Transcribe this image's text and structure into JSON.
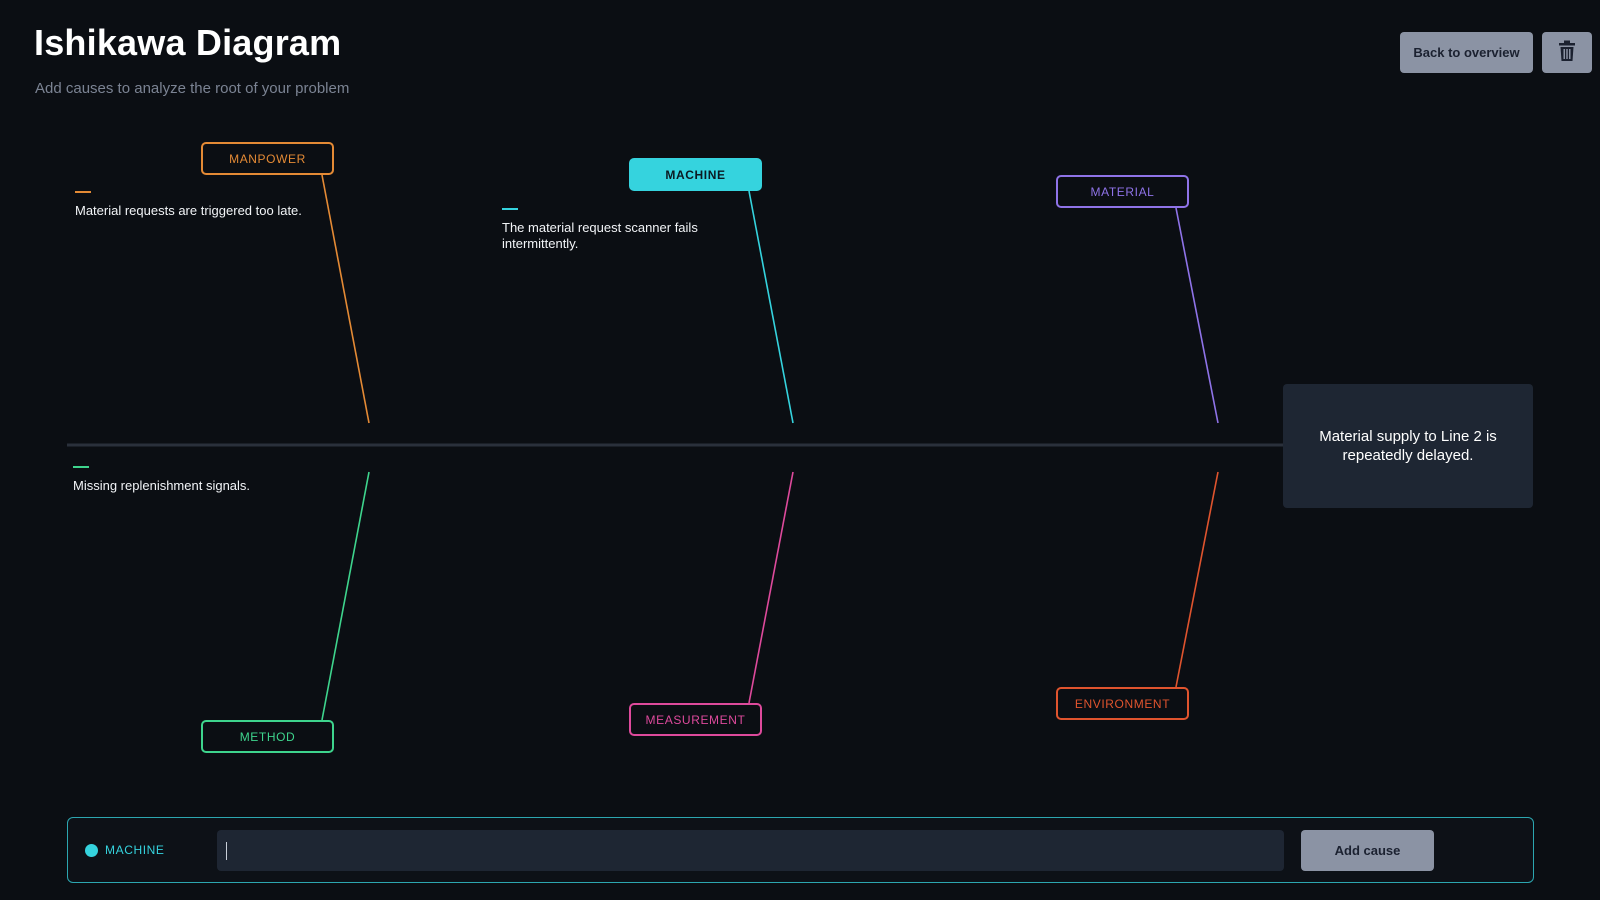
{
  "header": {
    "title": "Ishikawa Diagram",
    "subtitle": "Add causes to analyze the root of your problem",
    "back_label": "Back to overview"
  },
  "categories": {
    "manpower": {
      "label": "MANPOWER",
      "color": "#e48a35"
    },
    "machine": {
      "label": "MACHINE",
      "color": "#35d3de",
      "selected": true
    },
    "material": {
      "label": "MATERIAL",
      "color": "#8f73e8"
    },
    "method": {
      "label": "METHOD",
      "color": "#3ed48d"
    },
    "measurement": {
      "label": "MEASUREMENT",
      "color": "#de4a9c"
    },
    "environment": {
      "label": "ENVIRONMENT",
      "color": "#e0542e"
    }
  },
  "causes": {
    "manpower": [
      "Material requests are triggered too late."
    ],
    "machine": [
      "The material request scanner fails intermittently."
    ],
    "method": [
      "Missing replenishment signals."
    ]
  },
  "effect": "Material supply to Line 2 is repeatedly delayed.",
  "input_bar": {
    "selected_category": "MACHINE",
    "value": "",
    "add_label": "Add cause"
  },
  "icons": {
    "trash": "trash-icon",
    "category_dot": "dot-icon"
  }
}
